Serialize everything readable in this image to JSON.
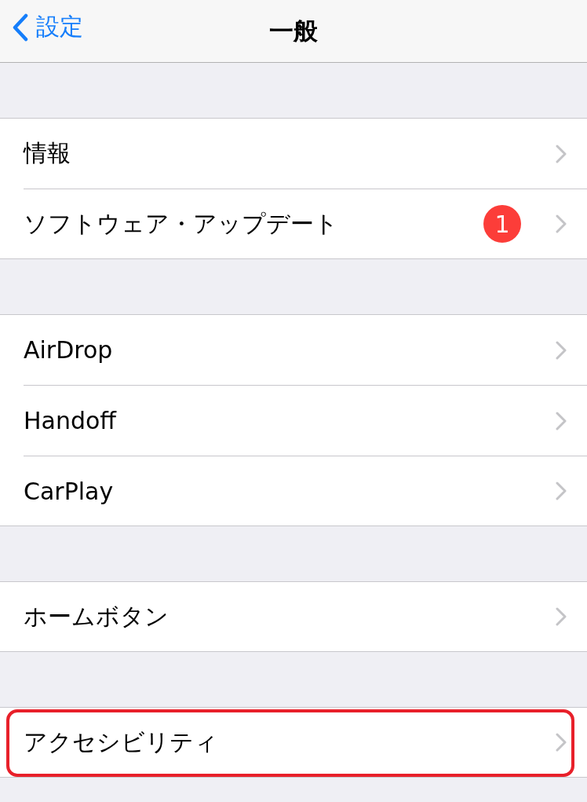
{
  "nav_bar": {
    "back_label": "設定",
    "title": "一般"
  },
  "groups": [
    {
      "items": [
        {
          "label": "情報",
          "highlighted": false
        },
        {
          "label": "ソフトウェア・アップデート",
          "badge": "1",
          "highlighted": false
        }
      ]
    },
    {
      "items": [
        {
          "label": "AirDrop",
          "highlighted": false
        },
        {
          "label": "Handoff",
          "highlighted": false
        },
        {
          "label": "CarPlay",
          "highlighted": false
        }
      ]
    },
    {
      "items": [
        {
          "label": "ホームボタン",
          "highlighted": false
        }
      ]
    },
    {
      "items": [
        {
          "label": "アクセシビリティ",
          "highlighted": true
        }
      ]
    }
  ]
}
